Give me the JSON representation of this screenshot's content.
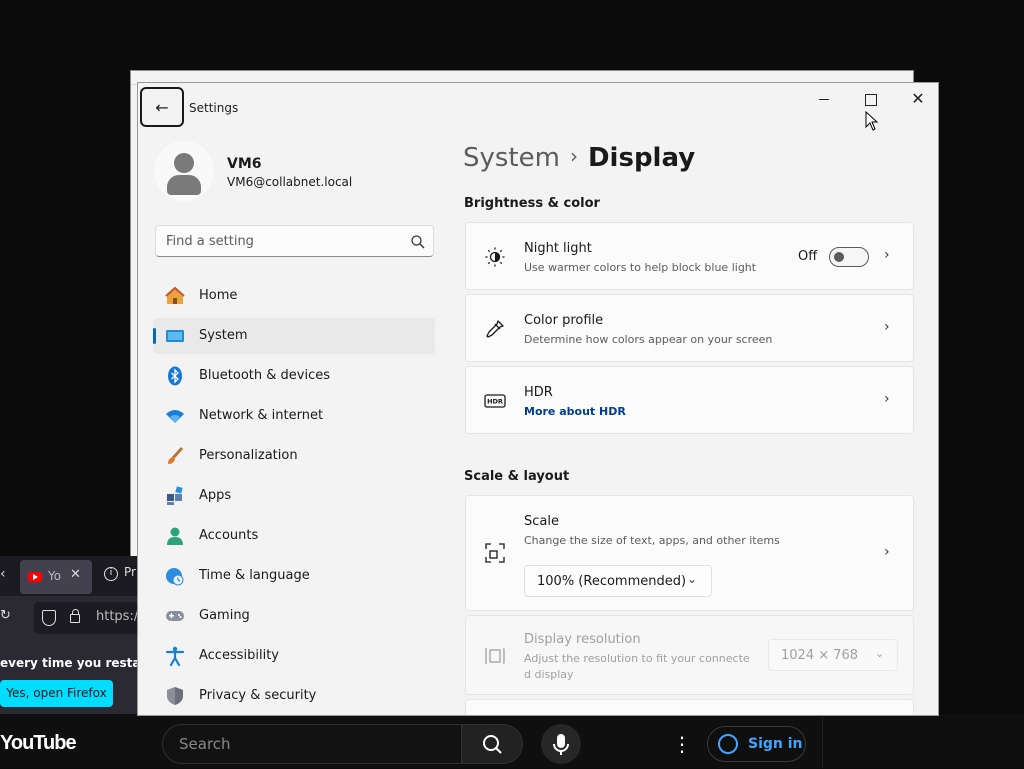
{
  "settings": {
    "window_title": "Settings",
    "user": {
      "name": "VM6",
      "email": "VM6@collabnet.local"
    },
    "search_placeholder": "Find a setting",
    "nav": [
      {
        "label": "Home",
        "icon": "home-icon"
      },
      {
        "label": "System",
        "icon": "system-icon",
        "active": true
      },
      {
        "label": "Bluetooth & devices",
        "icon": "bluetooth-icon"
      },
      {
        "label": "Network & internet",
        "icon": "wifi-icon"
      },
      {
        "label": "Personalization",
        "icon": "brush-icon"
      },
      {
        "label": "Apps",
        "icon": "apps-icon"
      },
      {
        "label": "Accounts",
        "icon": "accounts-icon"
      },
      {
        "label": "Time & language",
        "icon": "globe-clock-icon"
      },
      {
        "label": "Gaming",
        "icon": "gamepad-icon"
      },
      {
        "label": "Accessibility",
        "icon": "accessibility-icon"
      },
      {
        "label": "Privacy & security",
        "icon": "shield-icon"
      }
    ],
    "breadcrumb": {
      "parent": "System",
      "separator": "›",
      "current": "Display"
    },
    "brightness_section": "Brightness & color",
    "night_light": {
      "title": "Night light",
      "subtitle": "Use warmer colors to help block blue light",
      "toggle_label": "Off",
      "enabled": false
    },
    "color_profile": {
      "title": "Color profile",
      "subtitle": "Determine how colors appear on your screen"
    },
    "hdr": {
      "title": "HDR",
      "link": "More about HDR"
    },
    "scale_section": "Scale & layout",
    "scale": {
      "title": "Scale",
      "subtitle": "Change the size of text, apps, and other items",
      "value": "100% (Recommended)"
    },
    "display_resolution": {
      "title": "Display resolution",
      "subtitle_line1": "Adjust the resolution to fit your connecte",
      "subtitle_line2": "d display",
      "value": "1024 × 768"
    }
  },
  "firefox": {
    "tab_label": "Yo",
    "tab2_label": "Pr",
    "url": "https:/",
    "message": "every time you restart yo",
    "button": "Yes, open Firefox"
  },
  "youtube": {
    "logo": "YouTube",
    "search_placeholder": "Search",
    "signin": "Sign in"
  },
  "colors": {
    "accent": "#0067c0",
    "link": "#003e92",
    "firefox_button": "#00ddff",
    "youtube_link": "#3ea6ff"
  }
}
